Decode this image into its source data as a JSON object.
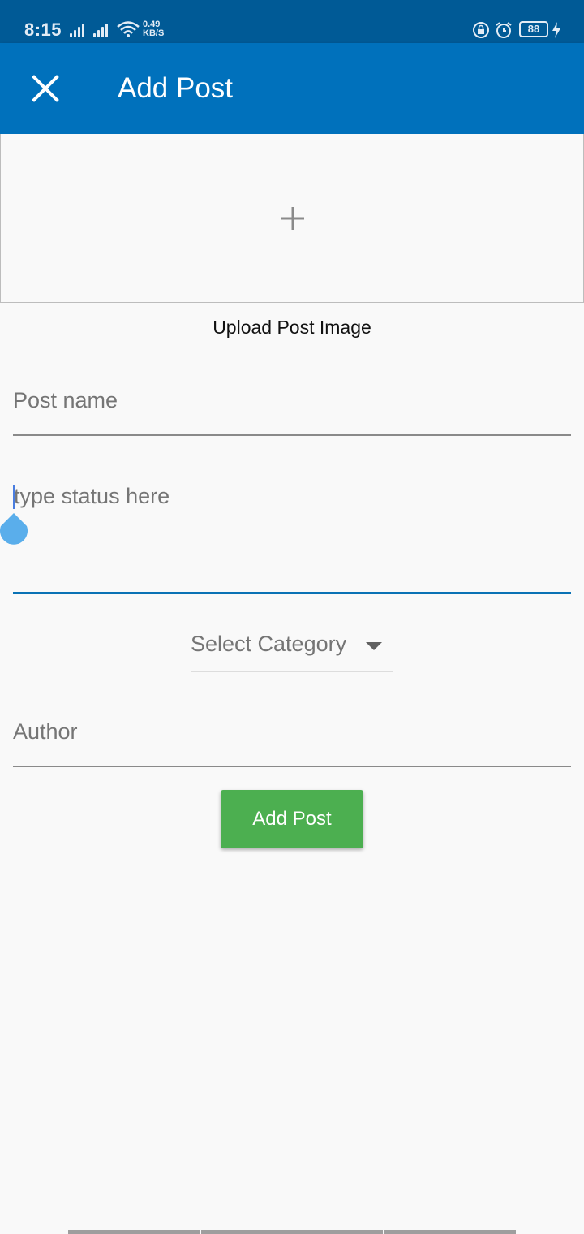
{
  "status_bar": {
    "time": "8:15",
    "net_speed_value": "0.49",
    "net_speed_unit": "KB/S",
    "battery": "88",
    "icons": [
      "signal-icon",
      "signal-icon",
      "wifi-icon",
      "rotation-lock-icon",
      "alarm-icon",
      "battery-icon",
      "charging-icon"
    ]
  },
  "app_bar": {
    "title": "Add Post",
    "close_icon": "close-icon",
    "background": "#0071bc"
  },
  "image_picker": {
    "icon": "plus-icon",
    "label": "Upload Post Image"
  },
  "form": {
    "post_name_placeholder": "Post name",
    "status_placeholder": "type status here",
    "category_placeholder": "Select Category",
    "author_placeholder": "Author",
    "submit_label": "Add Post"
  },
  "colors": {
    "accent": "#0a72b5",
    "button": "#4caf50",
    "status_bar": "#005a96"
  }
}
